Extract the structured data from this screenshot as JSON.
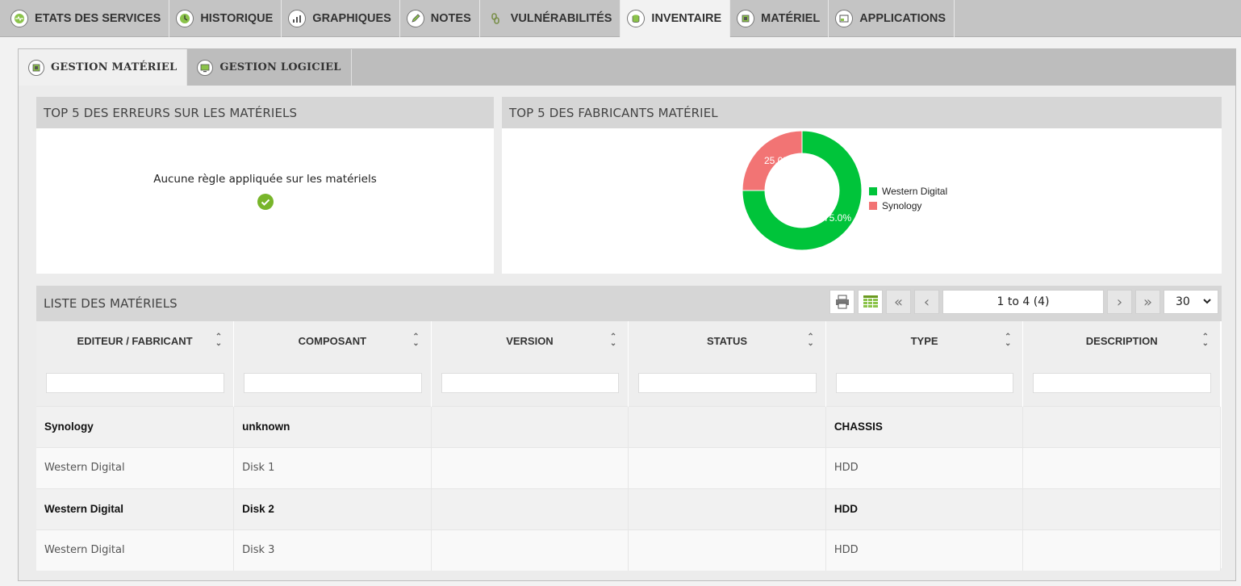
{
  "top_tabs": [
    {
      "label": "ETATS DES SERVICES",
      "icon": "heartbeat-icon"
    },
    {
      "label": "HISTORIQUE",
      "icon": "history-clock-icon"
    },
    {
      "label": "GRAPHIQUES",
      "icon": "bar-chart-icon"
    },
    {
      "label": "NOTES",
      "icon": "pencil-icon"
    },
    {
      "label": "VULNÉRABILITÉS",
      "icon": "chain-link-icon"
    },
    {
      "label": "INVENTAIRE",
      "icon": "database-icon"
    },
    {
      "label": "MATÉRIEL",
      "icon": "chip-icon"
    },
    {
      "label": "APPLICATIONS",
      "icon": "window-icon"
    }
  ],
  "sub_tabs": [
    {
      "label": "GESTION MATÉRIEL",
      "icon": "chip-icon"
    },
    {
      "label": "GESTION LOGICIEL",
      "icon": "monitor-icon"
    }
  ],
  "errors_panel": {
    "title": "TOP 5 DES ERREURS SUR LES MATÉRIELS",
    "message": "Aucune règle appliquée sur les matériels"
  },
  "manufacturers_panel": {
    "title": "TOP 5 DES FABRICANTS MATÉRIEL"
  },
  "chart_data": {
    "type": "pie",
    "donut": true,
    "title": "",
    "categories": [
      "Western Digital",
      "Synology"
    ],
    "values": [
      75.0,
      25.0
    ],
    "labels": [
      "75.0%",
      "25.0%"
    ],
    "colors": [
      "#00c43a",
      "#f27474"
    ],
    "legend_position": "right"
  },
  "list_panel": {
    "title": "LISTE DES MATÉRIELS",
    "pager_text": "1 to 4 (4)",
    "per_page": "30",
    "columns": [
      "EDITEUR / FABRICANT",
      "COMPOSANT",
      "VERSION",
      "STATUS",
      "TYPE",
      "DESCRIPTION"
    ],
    "rows": [
      {
        "vendor": "Synology",
        "component": "unknown",
        "version": "",
        "status": "",
        "type": "CHASSIS",
        "description": ""
      },
      {
        "vendor": "Western Digital",
        "component": "Disk 1",
        "version": "",
        "status": "",
        "type": "HDD",
        "description": ""
      },
      {
        "vendor": "Western Digital",
        "component": "Disk 2",
        "version": "",
        "status": "",
        "type": "HDD",
        "description": ""
      },
      {
        "vendor": "Western Digital",
        "component": "Disk 3",
        "version": "",
        "status": "",
        "type": "HDD",
        "description": ""
      }
    ]
  }
}
